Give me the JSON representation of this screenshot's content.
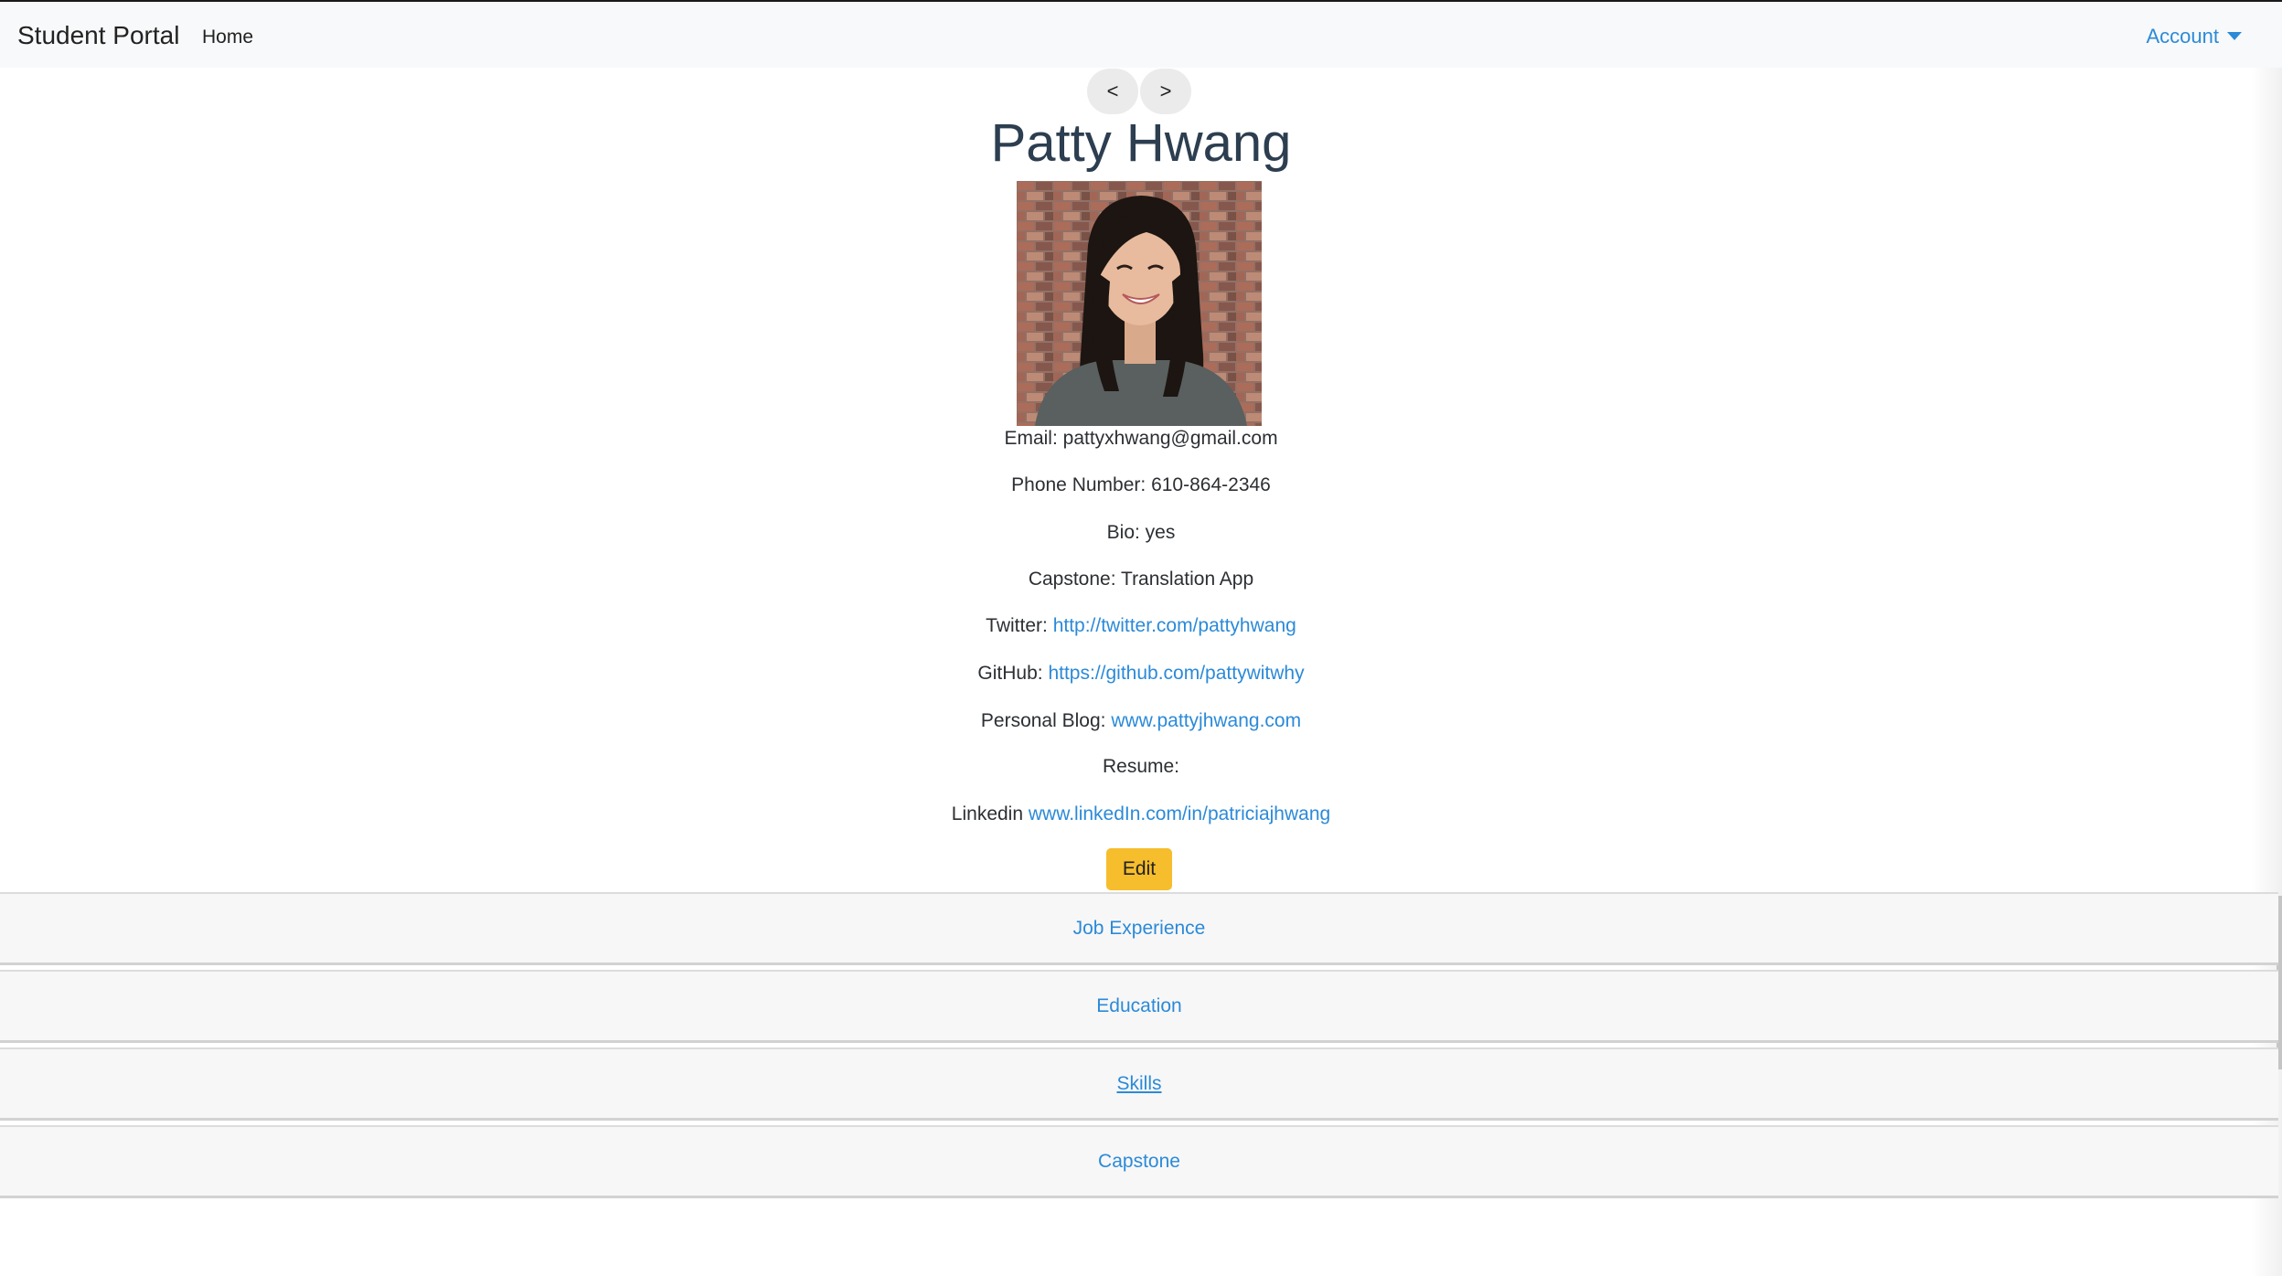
{
  "nav": {
    "brand": "Student Portal",
    "home": "Home",
    "account": "Account"
  },
  "pager": {
    "prev": "<",
    "next": ">"
  },
  "profile": {
    "name": "Patty Hwang",
    "photo_alt": "profile-photo",
    "email_label": "Email:",
    "email": "pattyxhwang@gmail.com",
    "phone_label": "Phone Number:",
    "phone": "610-864-2346",
    "bio_label": "Bio:",
    "bio": "yes",
    "capstone_label": "Capstone:",
    "capstone": "Translation App",
    "twitter_label": "Twitter:",
    "twitter": "http://twitter.com/pattyhwang",
    "github_label": "GitHub:",
    "github": "https://github.com/pattywitwhy",
    "blog_label": "Personal Blog:",
    "blog": "www.pattyjhwang.com",
    "resume_label": "Resume:",
    "linkedin_label": "Linkedin",
    "linkedin": "www.linkedIn.com/in/patriciajhwang",
    "edit": "Edit"
  },
  "sections": [
    {
      "label": "Job Experience"
    },
    {
      "label": "Education"
    },
    {
      "label": "Skills"
    },
    {
      "label": "Capstone"
    }
  ],
  "colors": {
    "link": "#2b8ad8",
    "edit_button": "#f6bd2d",
    "navbar_bg": "#f8f9fa",
    "section_bg": "#f7f7f7"
  }
}
